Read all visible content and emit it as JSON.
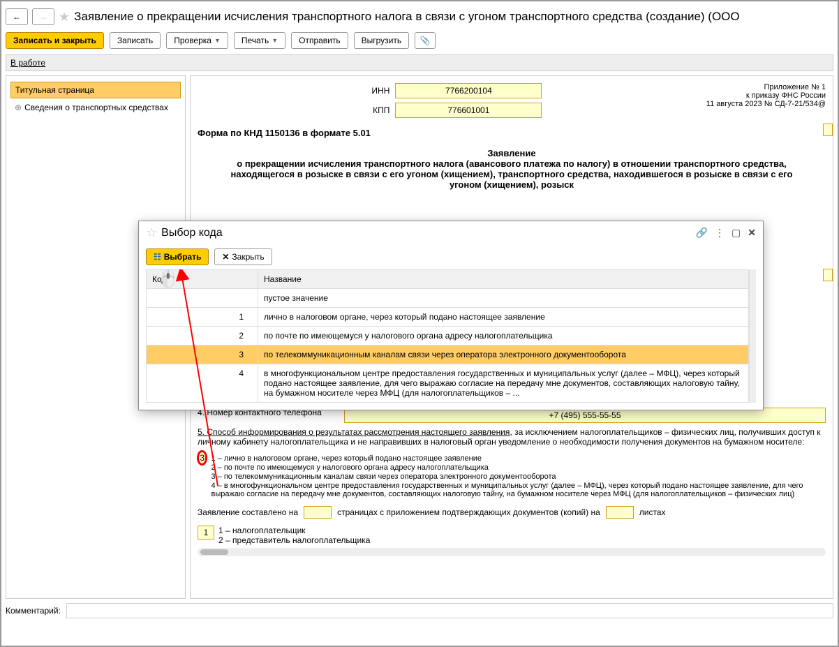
{
  "title": "Заявление о прекращении исчисления транспортного налога в связи с угоном транспортного средства (создание) (ООО",
  "toolbar": {
    "save_close": "Записать и закрыть",
    "write": "Записать",
    "check": "Проверка",
    "print": "Печать",
    "send": "Отправить",
    "export": "Выгрузить"
  },
  "status": {
    "in_work": "В работе"
  },
  "sidebar": {
    "title_page": "Титульная страница",
    "vehicles": "Сведения о транспортных средствах"
  },
  "header": {
    "inn_label": "ИНН",
    "inn": "7766200104",
    "kpp_label": "КПП",
    "kpp": "776601001",
    "appendix1": "Приложение № 1",
    "appendix2": "к приказу ФНС России",
    "appendix3": "11 августа 2023 № СД-7-21/534@"
  },
  "form_code": "Форма по КНД 1150136 в формате 5.01",
  "doc_title": "Заявление\nо прекращении исчисления транспортного налога (авансового платежа по налогу) в отношении транспортного средства, находящегося в розыске в связи с его угоном (хищением), транспортного средства, находившегося в розыске в связи с его угоном (хищением), розыск",
  "fields": {
    "phone_label": "4. Номер контактного телефона",
    "phone": "+7 (495) 555-55-55",
    "method_text_a": "5. Способ информирования о результатах рассмотрения настоящего заявления",
    "method_text_b": ", за исключением налогоплательщиков – физических лиц, получивших доступ к личному кабинету налогоплательщика и не направивших в налоговый орган уведомление о необходимости получения документов на бумажном носителе:",
    "method_value": "3",
    "method_options": [
      "1 – лично в налоговом органе, через который подано настоящее заявление",
      "2 – по почте по имеющемуся у налогового органа адресу налогоплательщика",
      "3 – по телекоммуникационным каналам связи через оператора электронного документооборота",
      "4 – в многофункциональном центре предоставления государственных и муниципальных услуг (далее – МФЦ), через который подано настоящее заявление, для чего выражаю согласие на передачу мне документов, составляющих налоговую тайну, на бумажном носителе через МФЦ (для налогоплательщиков – физических лиц)"
    ],
    "compiled_a": "Заявление составлено на",
    "compiled_b": "страницах с приложением подтверждающих документов (копий) на",
    "compiled_c": "листах",
    "declarant_value": "1",
    "declarant_options": [
      "1 – налогоплательщик",
      "2 – представитель налогоплательщика"
    ]
  },
  "comment_label": "Комментарий:",
  "modal": {
    "title": "Выбор кода",
    "select": "Выбрать",
    "close": "Закрыть",
    "col_code": "Код",
    "col_name": "Название",
    "rows": [
      {
        "code": "",
        "name": "пустое значение"
      },
      {
        "code": "1",
        "name": "лично в налоговом органе, через который подано настоящее заявление"
      },
      {
        "code": "2",
        "name": "по почте по имеющемуся у налогового органа адресу налогоплательщика"
      },
      {
        "code": "3",
        "name": "по телекоммуникационным каналам связи через оператора электронного документооборота"
      },
      {
        "code": "4",
        "name": "в многофункциональном центре предоставления государственных и муниципальных услуг (далее – МФЦ), через который подано настоящее заявление, для чего выражаю согласие на передачу мне документов, составляющих налоговую тайну, на бумажном носителе через МФЦ (для налогоплательщиков – ..."
      }
    ]
  }
}
